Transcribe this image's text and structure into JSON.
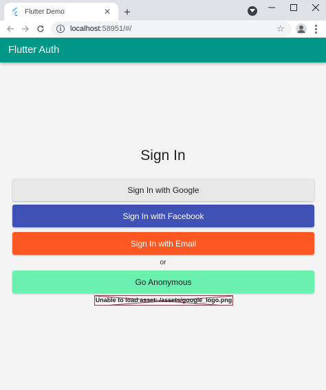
{
  "browser": {
    "tab_title": "Flutter Demo",
    "url_host": "localhost",
    "url_rest": ":58951/#/",
    "window_controls": [
      "minimize-icon",
      "maximize-icon",
      "close-icon"
    ]
  },
  "app": {
    "appbar_title": "Flutter Auth",
    "page_title": "Sign In",
    "buttons": {
      "google": "Sign In with Google",
      "facebook": "Sign In with Facebook",
      "email": "Sign In with Email",
      "anonymous": "Go Anonymous"
    },
    "or_label": "or",
    "error_message": "Unable to load asset: /assets/google_logo.png"
  },
  "colors": {
    "appbar": "#009688",
    "google": "#e7e7e7",
    "facebook": "#3f51b5",
    "email": "#ff5722",
    "anonymous": "#69f0ae",
    "error_border": "#8b3a4a"
  }
}
